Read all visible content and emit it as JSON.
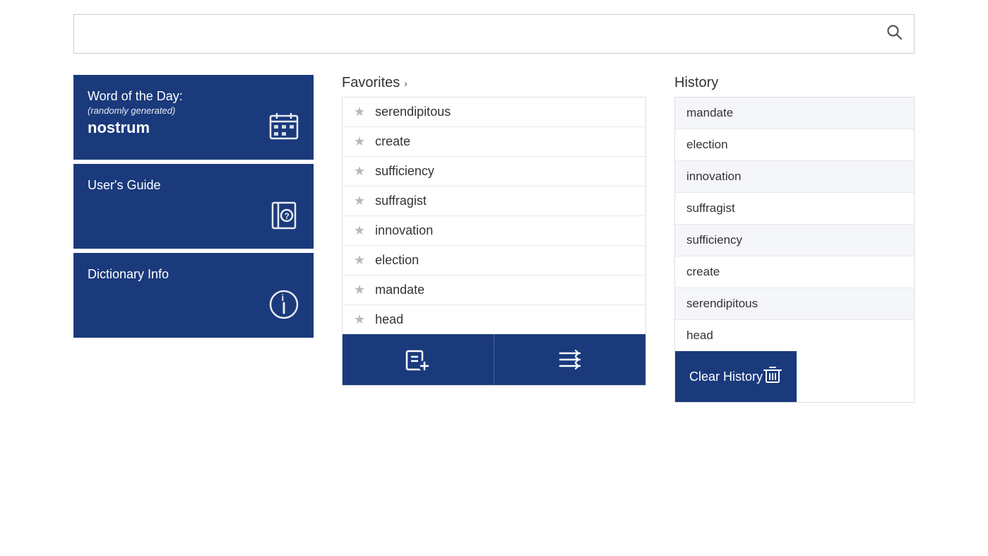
{
  "search": {
    "placeholder": "",
    "value": "",
    "icon": "🔍"
  },
  "sidebar": {
    "word_of_day": {
      "title": "Word of the Day:",
      "subtitle": "(randomly generated)",
      "word": "nostrum",
      "icon_label": "calendar-icon"
    },
    "users_guide": {
      "title": "User's Guide",
      "icon_label": "book-icon"
    },
    "dictionary_info": {
      "title": "Dictionary Info",
      "icon_label": "info-icon"
    }
  },
  "favorites": {
    "header": "Favorites",
    "chevron": "›",
    "items": [
      "serendipitous",
      "create",
      "sufficiency",
      "suffragist",
      "innovation",
      "election",
      "mandate",
      "head"
    ],
    "add_button_label": "add-favorite-icon",
    "manage_button_label": "manage-favorites-icon"
  },
  "history": {
    "header": "History",
    "items": [
      "mandate",
      "election",
      "innovation",
      "suffragist",
      "sufficiency",
      "create",
      "serendipitous",
      "head"
    ],
    "clear_label": "Clear History"
  }
}
